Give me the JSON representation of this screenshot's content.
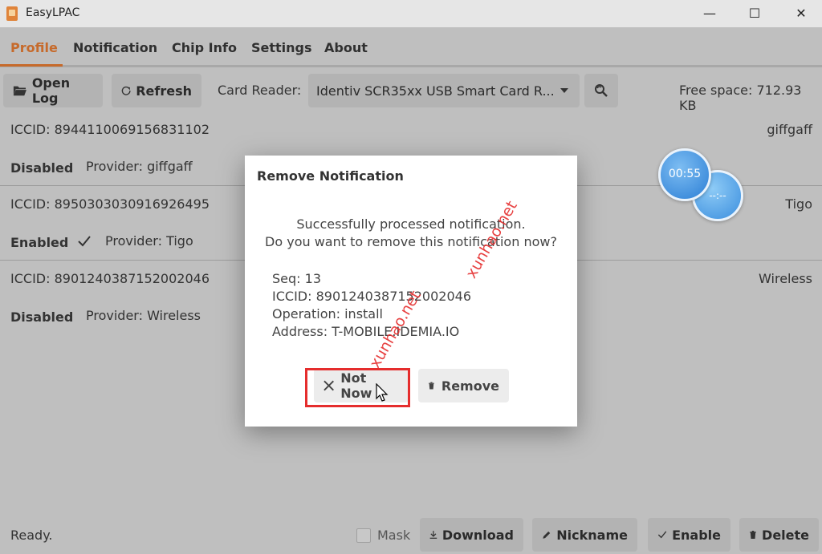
{
  "window": {
    "title": "EasyLPAC",
    "minimize": "—",
    "maximize": "☐",
    "close": "✕"
  },
  "tabs": [
    "Profile",
    "Notification",
    "Chip Info",
    "Settings",
    "About"
  ],
  "toolbar": {
    "open_log": "Open Log",
    "refresh": "Refresh",
    "card_reader_label": "Card Reader:",
    "card_reader_value": "Identiv SCR35xx USB Smart Card R...",
    "free_space": "Free space: 712.93 KB"
  },
  "profiles": [
    {
      "iccid": "ICCID: 8944110069156831102",
      "nickname": "giffgaff",
      "state": "Disabled",
      "provider": "Provider: giffgaff",
      "checked": false
    },
    {
      "iccid": "ICCID: 8950303030916926495",
      "nickname": "Tigo",
      "state": "Enabled",
      "provider": "Provider: Tigo",
      "checked": true
    },
    {
      "iccid": "ICCID: 8901240387152002046",
      "nickname": "Wireless",
      "state": "Disabled",
      "provider": "Provider: Wireless",
      "checked": false
    }
  ],
  "overlay": {
    "timer": "00:55",
    "timer2": "--:--"
  },
  "dialog": {
    "title": "Remove Notification",
    "message_line1": "Successfully processed notification.",
    "message_line2": "Do you want to remove this notification now?",
    "seq": "Seq: 13",
    "iccid": "ICCID: 8901240387152002046",
    "operation": "Operation: install",
    "address": "Address: T-MOBILE.IDEMIA.IO",
    "not_now": "Not Now",
    "remove": "Remove"
  },
  "watermark": {
    "text1": "xunhao.net",
    "text2": "xunhao.net"
  },
  "status": {
    "ready": "Ready.",
    "mask": "Mask",
    "download": "Download",
    "nickname": "Nickname",
    "enable": "Enable",
    "delete": "Delete"
  },
  "colors": {
    "accent": "#c66a2b",
    "highlight": "#e52d2d"
  }
}
